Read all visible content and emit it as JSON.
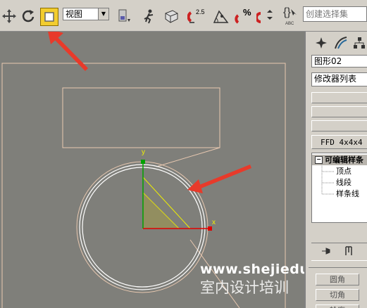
{
  "toolbar": {
    "view_dropdown": "视图",
    "named_selection_placeholder": "创建选择集",
    "spinner_snap_value": "2.5",
    "percent_snap_label": "%",
    "abc_label": "ABC",
    "icons": [
      "move-icon",
      "rotate-icon",
      "select-region-icon",
      "view-dropdown-chevron-icon",
      "pivot-icon",
      "manipulate-icon",
      "keyboard-shortcut-icon",
      "snap-toggle-icon",
      "angle-snap-icon",
      "percent-snap-icon",
      "spinner-snap-icon",
      "edit-named-selection-icon"
    ]
  },
  "viewport": {
    "axis_x_label": "x",
    "axis_y_label": "y",
    "watermark_url": "www.shejiedu.com",
    "watermark_text": "室内设计培训",
    "colors": {
      "background": "#7f7f7a",
      "shape": "#e8c8b0",
      "gizmo": "#f0f000",
      "axis_x": "#e00000",
      "axis_y": "#00a000",
      "arrow": "#e83a2a"
    }
  },
  "command_panel": {
    "tabs": [
      "create-tab-icon",
      "modify-tab-icon",
      "hierarchy-tab-icon"
    ],
    "object_name": "图形02",
    "modifier_list": "修改器列表",
    "ffd_label": "FFD 4x4x4",
    "stack": {
      "root": "可编辑样条",
      "items": [
        "顶点",
        "线段",
        "样条线"
      ]
    },
    "buttons": [
      "圆角",
      "切角",
      "轮廓"
    ]
  }
}
